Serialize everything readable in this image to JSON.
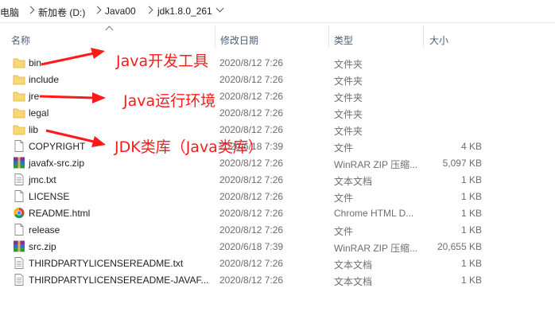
{
  "breadcrumb": {
    "items": [
      "电脑",
      "新加卷 (D:)",
      "Java00",
      "jdk1.8.0_261"
    ]
  },
  "columns": {
    "name": "名称",
    "modified": "修改日期",
    "type": "类型",
    "size": "大小"
  },
  "files": [
    {
      "name": "bin",
      "modified": "2020/8/12 7:26",
      "type": "文件夹",
      "size": "",
      "icon": "folder-icon"
    },
    {
      "name": "include",
      "modified": "2020/8/12 7:26",
      "type": "文件夹",
      "size": "",
      "icon": "folder-icon"
    },
    {
      "name": "jre",
      "modified": "2020/8/12 7:26",
      "type": "文件夹",
      "size": "",
      "icon": "folder-icon"
    },
    {
      "name": "legal",
      "modified": "2020/8/12 7:26",
      "type": "文件夹",
      "size": "",
      "icon": "folder-icon"
    },
    {
      "name": "lib",
      "modified": "2020/8/12 7:26",
      "type": "文件夹",
      "size": "",
      "icon": "folder-icon"
    },
    {
      "name": "COPYRIGHT",
      "modified": "2020/6/18 7:39",
      "type": "文件",
      "size": "4 KB",
      "icon": "file-icon"
    },
    {
      "name": "javafx-src.zip",
      "modified": "2020/8/12 7:26",
      "type": "WinRAR ZIP 压缩...",
      "size": "5,097 KB",
      "icon": "winrar-icon"
    },
    {
      "name": "jmc.txt",
      "modified": "2020/8/12 7:26",
      "type": "文本文档",
      "size": "1 KB",
      "icon": "text-file-icon"
    },
    {
      "name": "LICENSE",
      "modified": "2020/8/12 7:26",
      "type": "文件",
      "size": "1 KB",
      "icon": "file-icon"
    },
    {
      "name": "README.html",
      "modified": "2020/8/12 7:26",
      "type": "Chrome HTML D...",
      "size": "1 KB",
      "icon": "chrome-icon"
    },
    {
      "name": "release",
      "modified": "2020/8/12 7:26",
      "type": "文件",
      "size": "1 KB",
      "icon": "file-icon"
    },
    {
      "name": "src.zip",
      "modified": "2020/6/18 7:39",
      "type": "WinRAR ZIP 压缩...",
      "size": "20,655 KB",
      "icon": "winrar-icon"
    },
    {
      "name": "THIRDPARTYLICENSEREADME.txt",
      "modified": "2020/8/12 7:26",
      "type": "文本文档",
      "size": "1 KB",
      "icon": "text-file-icon"
    },
    {
      "name": "THIRDPARTYLICENSEREADME-JAVAF...",
      "modified": "2020/8/12 7:26",
      "type": "文本文档",
      "size": "1 KB",
      "icon": "text-file-icon"
    }
  ],
  "annotations": {
    "bin": "Java开发工具",
    "jre": "Java运行环境",
    "lib": "JDK类库（Java类库）",
    "color": "#ff1a1a"
  }
}
